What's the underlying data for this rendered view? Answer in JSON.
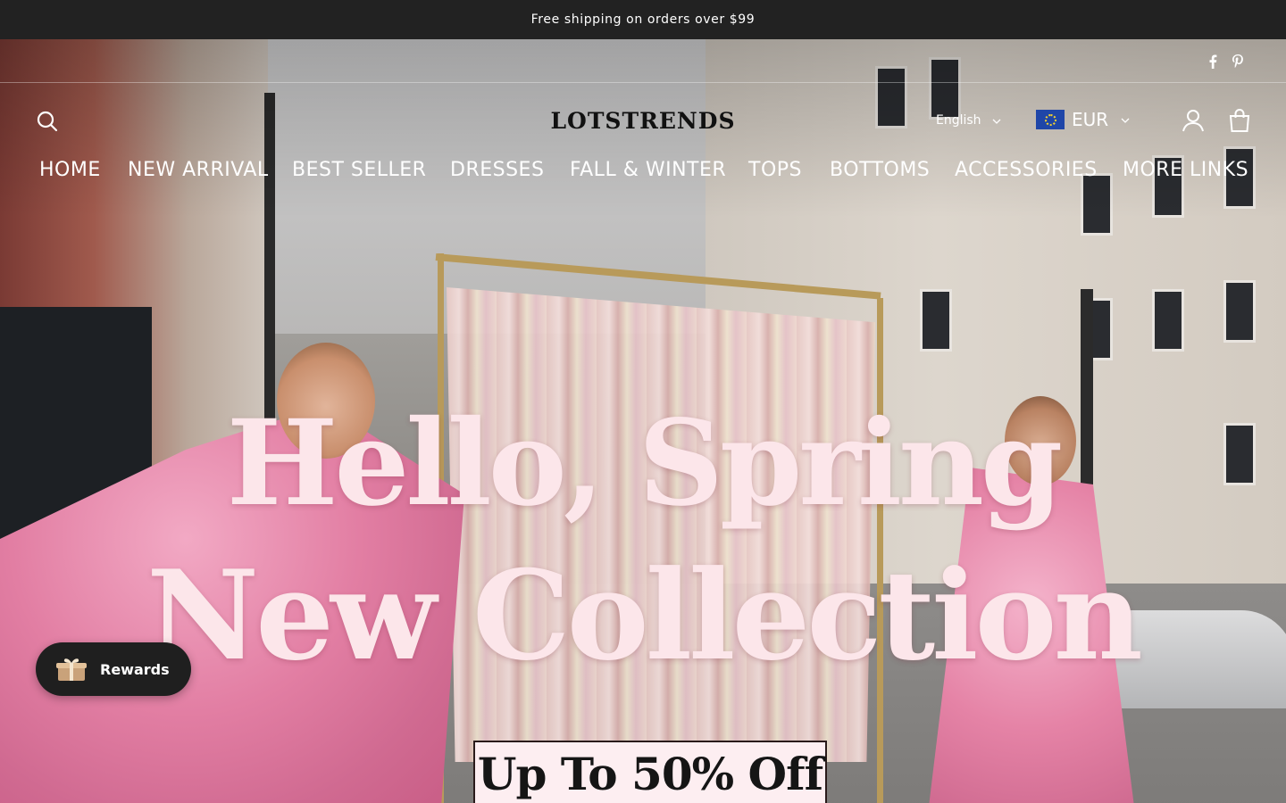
{
  "announcement": {
    "text": "Free shipping on orders over $99"
  },
  "social": [
    {
      "name": "facebook-icon",
      "glyph": "f"
    },
    {
      "name": "pinterest-icon",
      "glyph": "P"
    }
  ],
  "header": {
    "logo": "LOTSTRENDS",
    "language": {
      "selected": "English"
    },
    "currency": {
      "selected": "EUR",
      "flag": "eu-flag-icon"
    },
    "icons": [
      "search-icon",
      "account-icon",
      "cart-icon"
    ]
  },
  "nav": {
    "items": [
      "HOME",
      "NEW ARRIVAL",
      "BEST SELLER",
      "DRESSES",
      "FALL & WINTER",
      "TOPS",
      "BOTTOMS",
      "ACCESSORIES",
      "MORE LINKS"
    ]
  },
  "hero": {
    "headline_line1": "Hello, Spring",
    "headline_line2": "New Collection",
    "promo": "Up To 50% Off"
  },
  "rewards": {
    "label": "Rewards",
    "icon": "gift-box-icon"
  },
  "colors": {
    "announcement_bg": "#222222",
    "headline": "#fce6ea",
    "promo_bg": "#fdeef1",
    "rewards_bg": "#1f1f1f"
  }
}
